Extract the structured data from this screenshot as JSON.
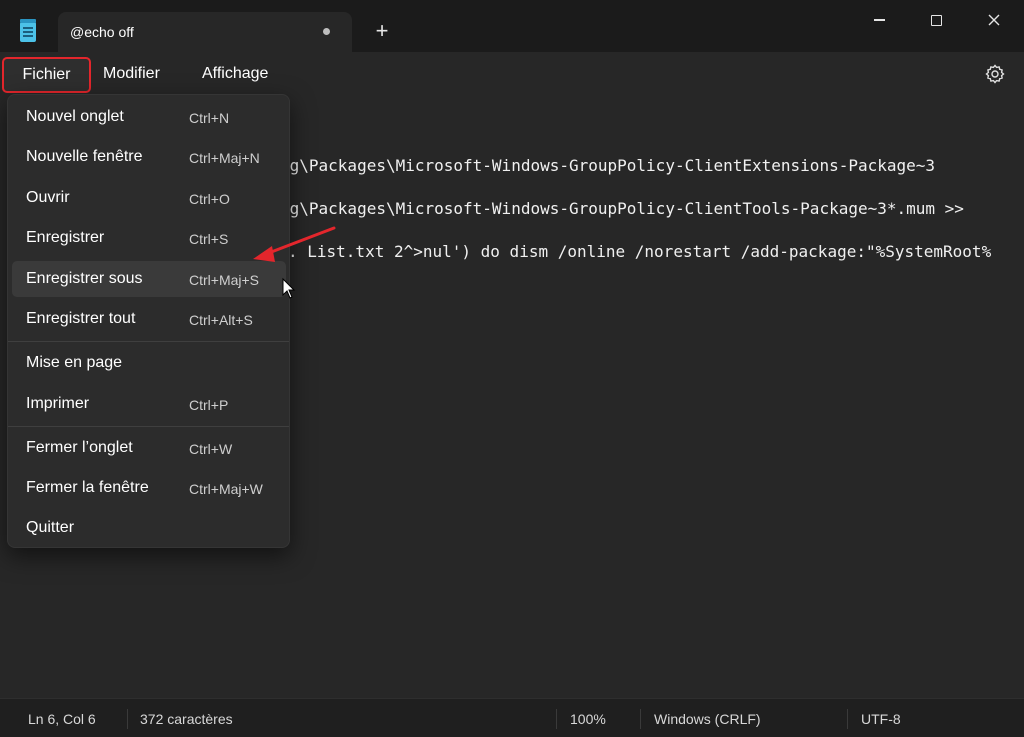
{
  "window": {
    "tab_title": "@echo off",
    "new_tab_glyph": "+"
  },
  "menubar": {
    "items": [
      "Fichier",
      "Modifier",
      "Affichage"
    ]
  },
  "editor": {
    "lines": [
      "ng\\Packages\\Microsoft-Windows-GroupPolicy-ClientExtensions-Package~3",
      "ng\\Packages\\Microsoft-Windows-GroupPolicy-ClientTools-Package~3*.mum >>",
      ". List.txt 2^>nul') do dism /online /norestart /add-package:\"%SystemRoot%"
    ]
  },
  "file_menu": {
    "items": [
      {
        "label": "Nouvel onglet",
        "shortcut": "Ctrl+N"
      },
      {
        "label": "Nouvelle fenêtre",
        "shortcut": "Ctrl+Maj+N"
      },
      {
        "label": "Ouvrir",
        "shortcut": "Ctrl+O"
      },
      {
        "label": "Enregistrer",
        "shortcut": "Ctrl+S"
      },
      {
        "label": "Enregistrer sous",
        "shortcut": "Ctrl+Maj+S"
      },
      {
        "label": "Enregistrer tout",
        "shortcut": "Ctrl+Alt+S"
      },
      {
        "label": "Mise en page",
        "shortcut": ""
      },
      {
        "label": "Imprimer",
        "shortcut": "Ctrl+P"
      },
      {
        "label": "Fermer l’onglet",
        "shortcut": "Ctrl+W"
      },
      {
        "label": "Fermer la fenêtre",
        "shortcut": "Ctrl+Maj+W"
      },
      {
        "label": "Quitter",
        "shortcut": ""
      }
    ]
  },
  "statusbar": {
    "position": "Ln 6, Col 6",
    "char_count": "372 caractères",
    "zoom": "100%",
    "line_ending": "Windows (CRLF)",
    "encoding": "UTF-8"
  },
  "colors": {
    "highlight_border": "#e3262c",
    "annotation_arrow": "#e3262c"
  },
  "icons": [
    "notepad-app-icon",
    "tab-unsaved-dot-icon",
    "plus-icon",
    "minimize-icon",
    "maximize-icon",
    "close-icon",
    "gear-icon",
    "mouse-cursor-icon",
    "annotation-arrow-icon"
  ]
}
